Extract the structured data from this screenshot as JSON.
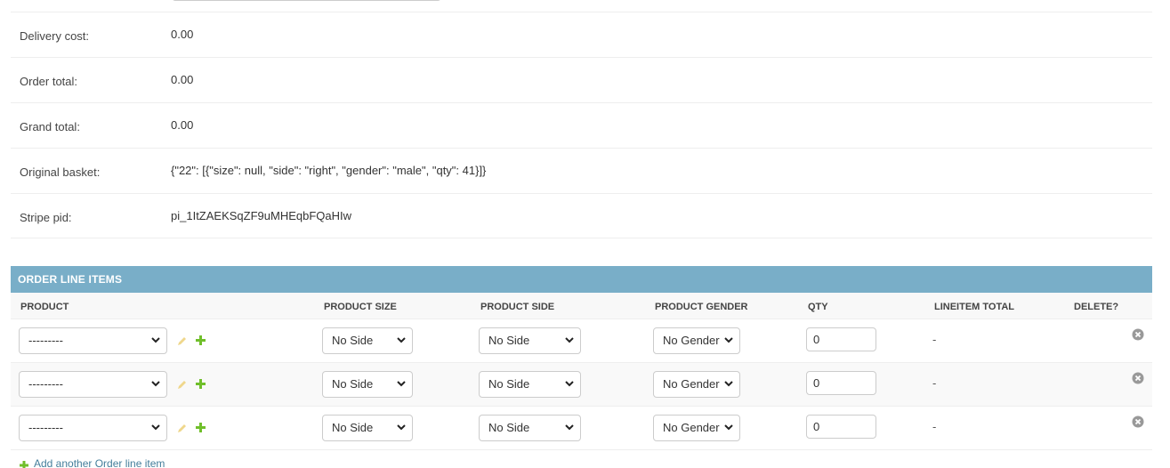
{
  "readonly_fields": [
    {
      "label": "Delivery cost:",
      "value": "0.00"
    },
    {
      "label": "Order total:",
      "value": "0.00"
    },
    {
      "label": "Grand total:",
      "value": "0.00"
    },
    {
      "label": "Original basket:",
      "value": "{\"22\": [{\"size\": null, \"side\": \"right\", \"gender\": \"male\", \"qty\": 41}]}"
    },
    {
      "label": "Stripe pid:",
      "value": "pi_1ItZAEKSqZF9uMHEqbFQaHIw"
    }
  ],
  "inline": {
    "title": "Order Line Items",
    "columns": {
      "product": "Product",
      "product_size": "Product Size",
      "product_side": "Product Side",
      "product_gender": "Product Gender",
      "qty": "Qty",
      "lineitem_total": "Lineitem Total",
      "delete": "Delete?"
    },
    "rows": [
      {
        "product": "---------",
        "size": "No Side",
        "side": "No Side",
        "gender": "No Gender",
        "qty": "0",
        "total": "-"
      },
      {
        "product": "---------",
        "size": "No Side",
        "side": "No Side",
        "gender": "No Gender",
        "qty": "0",
        "total": "-"
      },
      {
        "product": "---------",
        "size": "No Side",
        "side": "No Side",
        "gender": "No Gender",
        "qty": "0",
        "total": "-"
      }
    ],
    "add_link": "Add another Order line item"
  },
  "icons": {
    "edit": "pencil-icon",
    "add": "plus-icon",
    "delete": "delete-circle-icon",
    "dropdown": "chevron-down-icon"
  },
  "colors": {
    "header_bg": "#79aec8",
    "link": "#447e9b",
    "add_green": "#70bf2b",
    "edit_disabled": "#efd78c",
    "delete_grey": "#999999"
  }
}
